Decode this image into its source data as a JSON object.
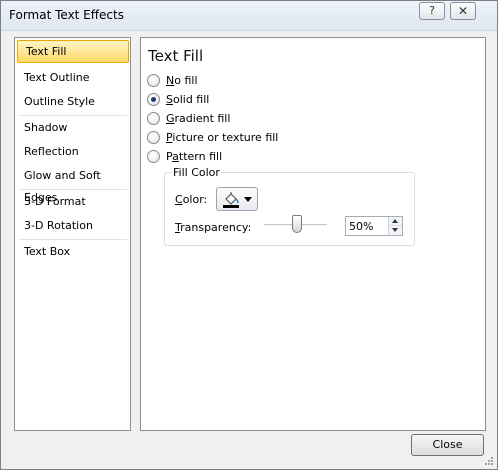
{
  "window": {
    "title": "Format Text Effects",
    "help_glyph": "?",
    "close_glyph": "✕"
  },
  "nav": {
    "items": [
      {
        "label": "Text Fill",
        "selected": true
      },
      {
        "label": "Text Outline"
      },
      {
        "label": "Outline Style"
      },
      {
        "label": "Shadow"
      },
      {
        "label": "Reflection"
      },
      {
        "label": "Glow and Soft Edges"
      },
      {
        "label": "3-D Format"
      },
      {
        "label": "3-D Rotation"
      },
      {
        "label": "Text Box"
      }
    ]
  },
  "panel": {
    "title": "Text Fill",
    "fill_options": [
      {
        "mnemonic": "N",
        "rest": "o fill",
        "checked": false
      },
      {
        "mnemonic": "S",
        "rest": "olid fill",
        "checked": true
      },
      {
        "mnemonic": "G",
        "rest": "radient fill",
        "checked": false
      },
      {
        "mnemonic": "P",
        "rest": "icture or texture fill",
        "checked": false
      },
      {
        "pre": "P",
        "mnemonic": "a",
        "rest": "ttern fill",
        "checked": false
      }
    ],
    "fill_color": {
      "group_title": "Fill Color",
      "color_label_mnemonic": "C",
      "color_label_rest": "olor:",
      "color_value": "#000000",
      "color_icon": "paint-bucket-icon",
      "transparency_label_mnemonic": "T",
      "transparency_label_rest": "ransparency:",
      "transparency_percent": 50,
      "transparency_text": "50%"
    }
  },
  "footer": {
    "close_label": "Close"
  },
  "colors": {
    "selection_fill": "#ffd965",
    "selection_border": "#e5a900",
    "radio_dot": "#1c3e74"
  }
}
